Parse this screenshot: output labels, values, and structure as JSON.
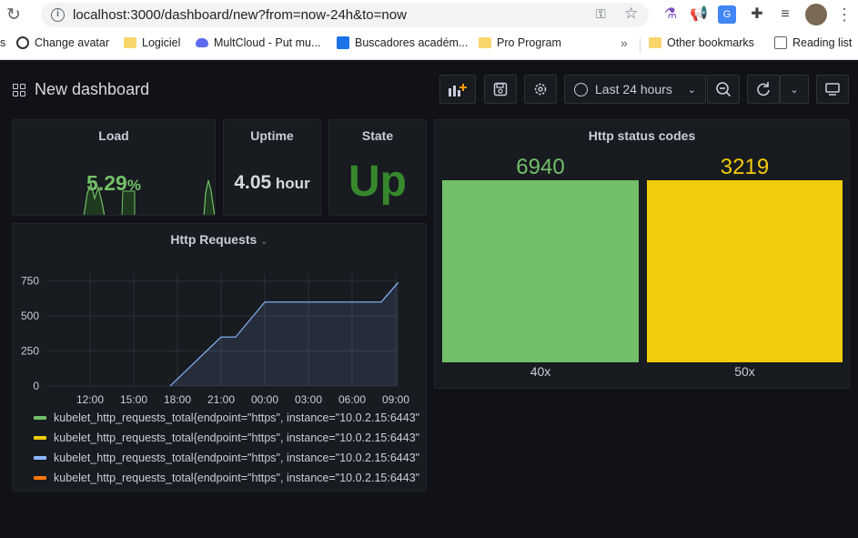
{
  "browser": {
    "url": "localhost:3000/dashboard/new?from=now-24h&to=now",
    "bookmarks": [
      {
        "label": "Change avatar",
        "icon": "github-icon"
      },
      {
        "label": "Logiciel",
        "icon": "folder-icon"
      },
      {
        "label": "MultCloud - Put mu...",
        "icon": "cloud-icon"
      },
      {
        "label": "Buscadores académ...",
        "icon": "search-site-icon"
      },
      {
        "label": "Pro Program",
        "icon": "folder-icon"
      }
    ],
    "overflow": "»",
    "other_bookmarks": "Other bookmarks",
    "reading_list": "Reading list",
    "left_edge_char": "s"
  },
  "dashboard": {
    "title": "New dashboard",
    "time_range": "Last 24 hours"
  },
  "panels": {
    "load": {
      "title": "Load",
      "value": "5.29",
      "unit": "%"
    },
    "uptime": {
      "title": "Uptime",
      "value": "4.05",
      "unit": " hour"
    },
    "state": {
      "title": "State",
      "value": "Up"
    },
    "http_status": {
      "title": "Http status codes",
      "bars": [
        {
          "label": "40x",
          "value": "6940",
          "color": "#73bf69"
        },
        {
          "label": "50x",
          "value": "3219",
          "color": "#f2cc0c"
        }
      ]
    },
    "http_requests": {
      "title": "Http Requests",
      "legend": [
        {
          "text": "kubelet_http_requests_total{endpoint=\"https\", instance=\"10.0.2.15:6443\",",
          "color": "#73bf69"
        },
        {
          "text": "kubelet_http_requests_total{endpoint=\"https\", instance=\"10.0.2.15:6443\",",
          "color": "#f2cc0c"
        },
        {
          "text": "kubelet_http_requests_total{endpoint=\"https\", instance=\"10.0.2.15:6443\",",
          "color": "#8ab8ff"
        },
        {
          "text": "kubelet_http_requests_total{endpoint=\"https\", instance=\"10.0.2.15:6443\",",
          "color": "#ff780a"
        }
      ]
    }
  },
  "chart_data": {
    "type": "line",
    "title": "Http Requests",
    "xlabel": "",
    "ylabel": "",
    "x_ticks": [
      "12:00",
      "15:00",
      "18:00",
      "21:00",
      "00:00",
      "03:00",
      "06:00",
      "09:00"
    ],
    "y_ticks": [
      0,
      250,
      500,
      750
    ],
    "ylim": [
      0,
      800
    ],
    "grid": true,
    "series": [
      {
        "color": "#8ab8ff",
        "points": [
          [
            "17:30",
            0
          ],
          [
            "21:00",
            350
          ],
          [
            "22:00",
            350
          ],
          [
            "00:00",
            600
          ],
          [
            "08:00",
            600
          ],
          [
            "09:10",
            740
          ]
        ]
      }
    ]
  }
}
